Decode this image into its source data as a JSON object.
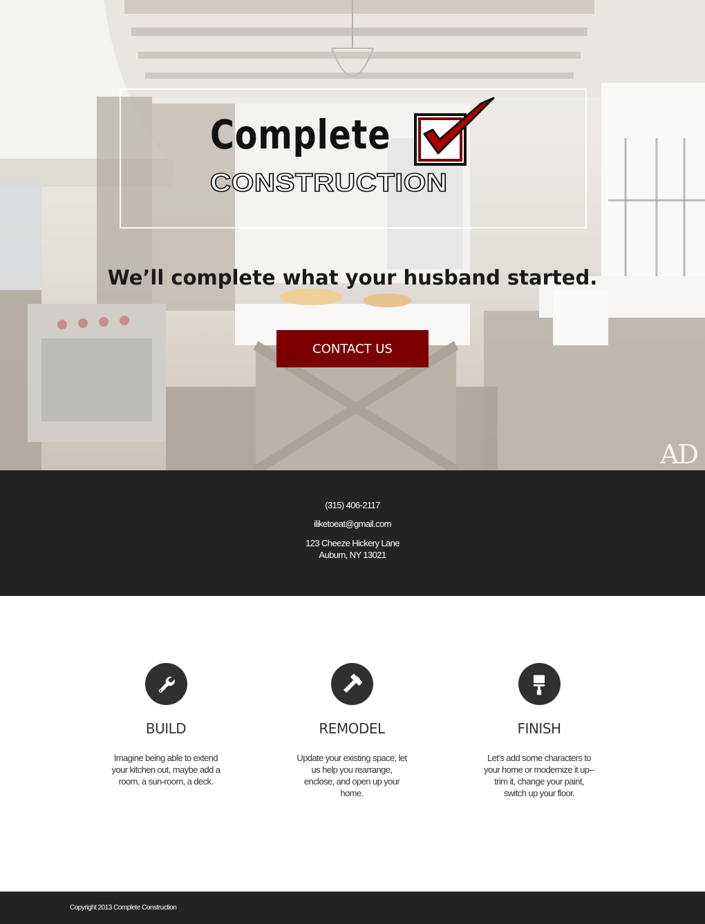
{
  "hero": {
    "logo_word_1": "Complete",
    "logo_word_2": "CONSTRUCTION",
    "tagline": "We’ll complete what your husband started.",
    "cta_label": "CONTACT US",
    "watermark": "AD",
    "accent_color": "#7d0000"
  },
  "contact": {
    "phone": "(315) 406-2117",
    "email": "iliketoeat@gmail.com",
    "address_line_1": "123 Cheeze Hickery Lane",
    "address_line_2": "Auburn, NY 13021"
  },
  "services": [
    {
      "icon": "wrench-icon",
      "title": "BUILD",
      "text": "Imagine being able to extend your kitchen out, maybe add a room, a sun-room, a deck."
    },
    {
      "icon": "hammer-ruler-icon",
      "title": "REMODEL",
      "text": "Update your existing space, let us help you rearrange, enclose, and open up your home."
    },
    {
      "icon": "paint-roller-icon",
      "title": "FINISH",
      "text": "Let’s add some characters to your home or modernize it up--trim it, change your paint, switch up your floor."
    }
  ],
  "footer": {
    "copyright": "Copyright 2013 Complete Construction"
  }
}
